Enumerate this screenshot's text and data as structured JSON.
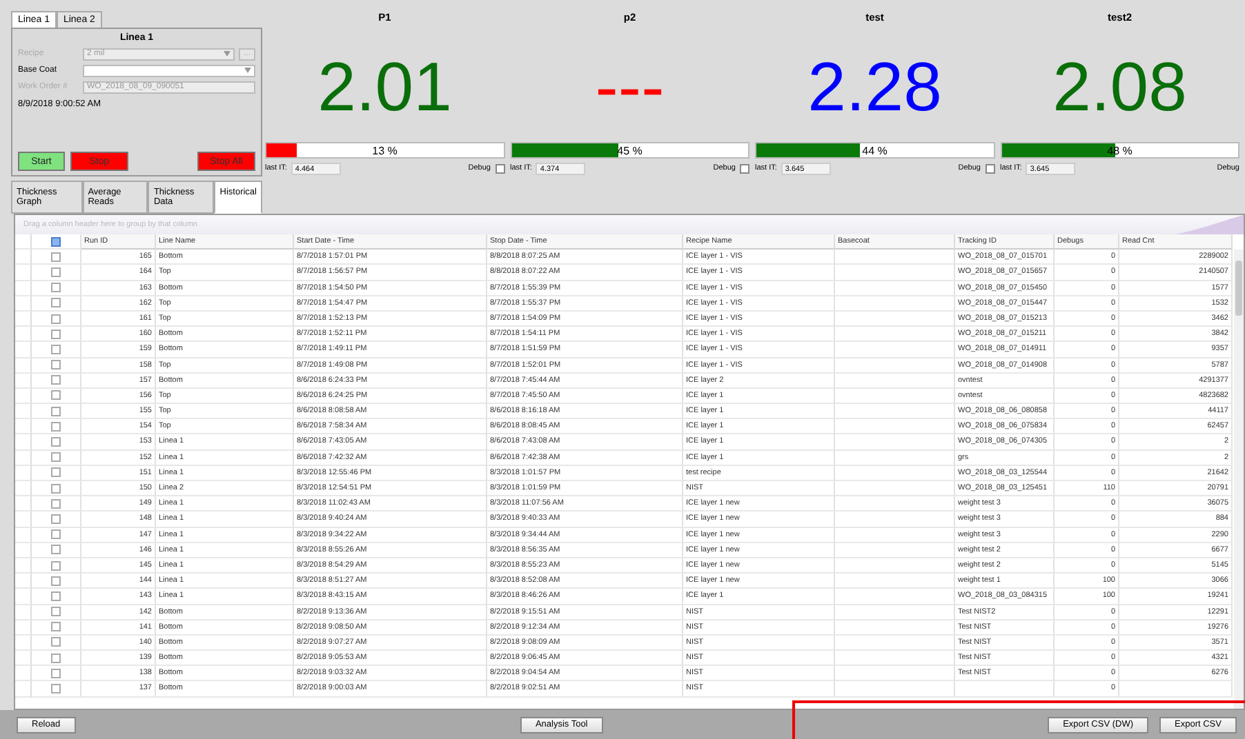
{
  "line_tabs": [
    {
      "label": "Linea 1",
      "selected": true
    },
    {
      "label": "Linea 2",
      "selected": false
    }
  ],
  "line_panel": {
    "title": "Linea 1",
    "fields": [
      {
        "kind": "dropdown",
        "label": "Recipe",
        "value": "2 mil",
        "disabled": true,
        "browse": "..."
      },
      {
        "kind": "dropdown",
        "label": "Base Coat",
        "disabled": false
      },
      {
        "kind": "text",
        "label": "Work Order #",
        "value": "WO_2018_08_09_090051",
        "disabled": true
      }
    ],
    "timestamp": "8/9/2018 9:00:52 AM",
    "buttons": [
      {
        "label": "Start",
        "kind": "start"
      },
      {
        "label": "Stop",
        "kind": "stop"
      },
      {
        "label": "Stop All",
        "kind": "stop"
      }
    ]
  },
  "view_tabs": [
    {
      "label": "Thickness Graph",
      "selected": false
    },
    {
      "label": "Average Reads",
      "selected": false
    },
    {
      "label": "Thickness Data",
      "selected": false
    },
    {
      "label": "Historical",
      "selected": true
    }
  ],
  "gauges": [
    {
      "name": "P1",
      "reading": {
        "text": "2.01",
        "color": "#0a6e0a"
      },
      "progress": {
        "level": 0.13,
        "label": "13 %",
        "color": "#ff0000"
      },
      "last_it_label": "last IT:",
      "last_it": "4.464",
      "debug_label": "Debug",
      "debug_checked": false
    },
    {
      "name": "p2",
      "reading": {
        "text": "---",
        "color": "#ff0000"
      },
      "progress": {
        "level": 0.45,
        "label": "45 %",
        "color": "#0a7a0a"
      },
      "last_it_label": "last IT:",
      "last_it": "4.374",
      "debug_label": "Debug",
      "debug_checked": false
    },
    {
      "name": "test",
      "reading": {
        "text": "2.28",
        "color": "#0000ff"
      },
      "progress": {
        "level": 0.44,
        "label": "44 %",
        "color": "#0a7a0a"
      },
      "last_it_label": "last IT:",
      "last_it": "3.645",
      "debug_label": "Debug",
      "debug_checked": false
    },
    {
      "name": "test2",
      "reading": {
        "text": "2.08",
        "color": "#0a6e0a"
      },
      "progress": {
        "level": 0.48,
        "label": "48 %",
        "color": "#0a7a0a"
      },
      "last_it_label": "last IT:",
      "last_it": "3.645",
      "debug_label": "Debug"
    }
  ],
  "group_hint": "Drag a column header here to group by that column",
  "table": {
    "select_all_checked": true,
    "columns": [
      "Run ID",
      "Line Name",
      "Start Date - Time",
      "Stop Date - Time",
      "Recipe Name",
      "Basecoat",
      "Tracking ID",
      "Debugs",
      "Read Cnt"
    ],
    "rows": [
      {
        "checked": false,
        "run_id": "165",
        "line": "Bottom",
        "start": "8/7/2018 1:57:01 PM",
        "stop": "8/8/2018 8:07:25 AM",
        "recipe": "ICE layer 1 - VIS",
        "tracking": "WO_2018_08_07_015701",
        "debugs": "0",
        "reads": "2289002"
      },
      {
        "checked": false,
        "run_id": "164",
        "line": "Top",
        "start": "8/7/2018 1:56:57 PM",
        "stop": "8/8/2018 8:07:22 AM",
        "recipe": "ICE layer 1 - VIS",
        "tracking": "WO_2018_08_07_015657",
        "debugs": "0",
        "reads": "2140507"
      },
      {
        "checked": false,
        "run_id": "163",
        "line": "Bottom",
        "start": "8/7/2018 1:54:50 PM",
        "stop": "8/7/2018 1:55:39 PM",
        "recipe": "ICE layer 1 - VIS",
        "tracking": "WO_2018_08_07_015450",
        "debugs": "0",
        "reads": "1577"
      },
      {
        "checked": false,
        "run_id": "162",
        "line": "Top",
        "start": "8/7/2018 1:54:47 PM",
        "stop": "8/7/2018 1:55:37 PM",
        "recipe": "ICE layer 1 - VIS",
        "tracking": "WO_2018_08_07_015447",
        "debugs": "0",
        "reads": "1532"
      },
      {
        "checked": false,
        "run_id": "161",
        "line": "Top",
        "start": "8/7/2018 1:52:13 PM",
        "stop": "8/7/2018 1:54:09 PM",
        "recipe": "ICE layer 1 - VIS",
        "tracking": "WO_2018_08_07_015213",
        "debugs": "0",
        "reads": "3462"
      },
      {
        "checked": false,
        "run_id": "160",
        "line": "Bottom",
        "start": "8/7/2018 1:52:11 PM",
        "stop": "8/7/2018 1:54:11 PM",
        "recipe": "ICE layer 1 - VIS",
        "tracking": "WO_2018_08_07_015211",
        "debugs": "0",
        "reads": "3842"
      },
      {
        "checked": false,
        "run_id": "159",
        "line": "Bottom",
        "start": "8/7/2018 1:49:11 PM",
        "stop": "8/7/2018 1:51:59 PM",
        "recipe": "ICE layer 1 - VIS",
        "tracking": "WO_2018_08_07_014911",
        "debugs": "0",
        "reads": "9357"
      },
      {
        "checked": false,
        "run_id": "158",
        "line": "Top",
        "start": "8/7/2018 1:49:08 PM",
        "stop": "8/7/2018 1:52:01 PM",
        "recipe": "ICE layer 1 - VIS",
        "tracking": "WO_2018_08_07_014908",
        "debugs": "0",
        "reads": "5787"
      },
      {
        "checked": false,
        "run_id": "157",
        "line": "Bottom",
        "start": "8/6/2018 6:24:33 PM",
        "stop": "8/7/2018 7:45:44 AM",
        "recipe": "ICE layer 2",
        "tracking": "ovntest",
        "debugs": "0",
        "reads": "4291377"
      },
      {
        "checked": false,
        "run_id": "156",
        "line": "Top",
        "start": "8/6/2018 6:24:25 PM",
        "stop": "8/7/2018 7:45:50 AM",
        "recipe": "ICE layer 1",
        "tracking": "ovntest",
        "debugs": "0",
        "reads": "4823682"
      },
      {
        "checked": false,
        "run_id": "155",
        "line": "Top",
        "start": "8/6/2018 8:08:58 AM",
        "stop": "8/6/2018 8:16:18 AM",
        "recipe": "ICE layer 1",
        "tracking": "WO_2018_08_06_080858",
        "debugs": "0",
        "reads": "44117"
      },
      {
        "checked": false,
        "run_id": "154",
        "line": "Top",
        "start": "8/6/2018 7:58:34 AM",
        "stop": "8/6/2018 8:08:45 AM",
        "recipe": "ICE layer 1",
        "tracking": "WO_2018_08_06_075834",
        "debugs": "0",
        "reads": "62457"
      },
      {
        "checked": false,
        "run_id": "153",
        "line": "Linea 1",
        "start": "8/6/2018 7:43:05 AM",
        "stop": "8/6/2018 7:43:08 AM",
        "recipe": "ICE layer 1",
        "tracking": "WO_2018_08_06_074305",
        "debugs": "0",
        "reads": "2"
      },
      {
        "checked": false,
        "run_id": "152",
        "line": "Linea 1",
        "start": "8/6/2018 7:42:32 AM",
        "stop": "8/6/2018 7:42:38 AM",
        "recipe": "ICE layer 1",
        "tracking": "grs",
        "debugs": "0",
        "reads": "2"
      },
      {
        "checked": false,
        "run_id": "151",
        "line": "Linea 1",
        "start": "8/3/2018 12:55:46 PM",
        "stop": "8/3/2018 1:01:57 PM",
        "recipe": "test recipe",
        "tracking": "WO_2018_08_03_125544",
        "debugs": "0",
        "reads": "21642"
      },
      {
        "checked": false,
        "run_id": "150",
        "line": "Linea 2",
        "start": "8/3/2018 12:54:51 PM",
        "stop": "8/3/2018 1:01:59 PM",
        "recipe": "NIST",
        "tracking": "WO_2018_08_03_125451",
        "debugs": "110",
        "reads": "20791"
      },
      {
        "checked": false,
        "run_id": "149",
        "line": "Linea 1",
        "start": "8/3/2018 11:02:43 AM",
        "stop": "8/3/2018 11:07:56 AM",
        "recipe": "ICE layer 1 new",
        "tracking": "weight test 3",
        "debugs": "0",
        "reads": "36075"
      },
      {
        "checked": false,
        "run_id": "148",
        "line": "Linea 1",
        "start": "8/3/2018 9:40:24 AM",
        "stop": "8/3/2018 9:40:33 AM",
        "recipe": "ICE layer 1 new",
        "tracking": "weight test 3",
        "debugs": "0",
        "reads": "884"
      },
      {
        "checked": false,
        "run_id": "147",
        "line": "Linea 1",
        "start": "8/3/2018 9:34:22 AM",
        "stop": "8/3/2018 9:34:44 AM",
        "recipe": "ICE layer 1 new",
        "tracking": "weight test 3",
        "debugs": "0",
        "reads": "2290"
      },
      {
        "checked": false,
        "run_id": "146",
        "line": "Linea 1",
        "start": "8/3/2018 8:55:26 AM",
        "stop": "8/3/2018 8:56:35 AM",
        "recipe": "ICE layer 1 new",
        "tracking": "weight test 2",
        "debugs": "0",
        "reads": "6677"
      },
      {
        "checked": false,
        "run_id": "145",
        "line": "Linea 1",
        "start": "8/3/2018 8:54:29 AM",
        "stop": "8/3/2018 8:55:23 AM",
        "recipe": "ICE layer 1 new",
        "tracking": "weight test 2",
        "debugs": "0",
        "reads": "5145"
      },
      {
        "checked": false,
        "run_id": "144",
        "line": "Linea 1",
        "start": "8/3/2018 8:51:27 AM",
        "stop": "8/3/2018 8:52:08 AM",
        "recipe": "ICE layer 1 new",
        "tracking": "weight test 1",
        "debugs": "100",
        "reads": "3066"
      },
      {
        "checked": false,
        "run_id": "143",
        "line": "Linea 1",
        "start": "8/3/2018 8:43:15 AM",
        "stop": "8/3/2018 8:46:26 AM",
        "recipe": "ICE layer 1",
        "tracking": "WO_2018_08_03_084315",
        "debugs": "100",
        "reads": "19241"
      },
      {
        "checked": false,
        "run_id": "142",
        "line": "Bottom",
        "start": "8/2/2018 9:13:36 AM",
        "stop": "8/2/2018 9:15:51 AM",
        "recipe": "NIST",
        "tracking": "Test NIST2",
        "debugs": "0",
        "reads": "12291"
      },
      {
        "checked": false,
        "run_id": "141",
        "line": "Bottom",
        "start": "8/2/2018 9:08:50 AM",
        "stop": "8/2/2018 9:12:34 AM",
        "recipe": "NIST",
        "tracking": "Test NIST",
        "debugs": "0",
        "reads": "19276"
      },
      {
        "checked": false,
        "run_id": "140",
        "line": "Bottom",
        "start": "8/2/2018 9:07:27 AM",
        "stop": "8/2/2018 9:08:09 AM",
        "recipe": "NIST",
        "tracking": "Test NIST",
        "debugs": "0",
        "reads": "3571"
      },
      {
        "checked": false,
        "run_id": "139",
        "line": "Bottom",
        "start": "8/2/2018 9:05:53 AM",
        "stop": "8/2/2018 9:06:45 AM",
        "recipe": "NIST",
        "tracking": "Test NIST",
        "debugs": "0",
        "reads": "4321"
      },
      {
        "checked": false,
        "run_id": "138",
        "line": "Bottom",
        "start": "8/2/2018 9:03:32 AM",
        "stop": "8/2/2018 9:04:54 AM",
        "recipe": "NIST",
        "tracking": "Test NIST",
        "debugs": "0",
        "reads": "6276"
      },
      {
        "checked": false,
        "run_id": "137",
        "line": "Bottom",
        "start": "8/2/2018 9:00:03 AM",
        "stop": "8/2/2018 9:02:51 AM",
        "recipe": "NIST",
        "debugs": "0"
      }
    ]
  },
  "footer_buttons": [
    {
      "label": "Reload",
      "kind": "reload"
    },
    {
      "label": "Analysis Tool",
      "kind": "analysis"
    },
    {
      "label": "Export CSV (DW)",
      "kind": "export"
    },
    {
      "label": "Export CSV",
      "kind": "export"
    }
  ]
}
